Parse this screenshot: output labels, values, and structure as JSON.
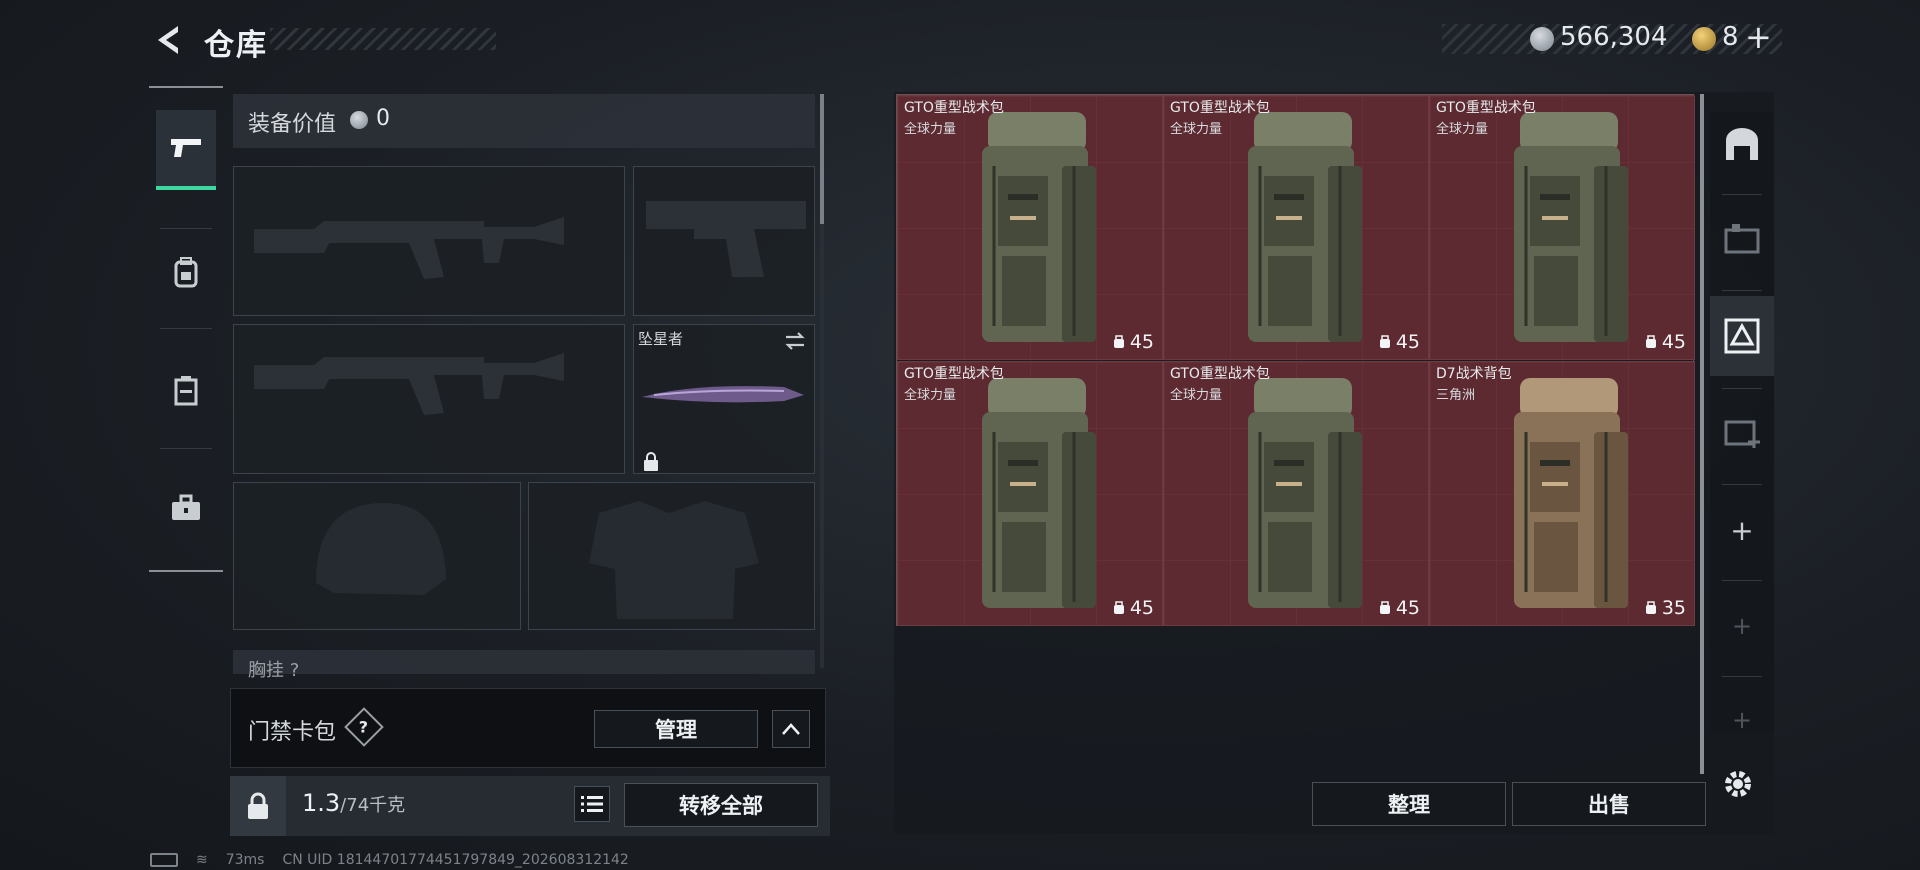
{
  "header": {
    "title": "仓库"
  },
  "currency": {
    "silver": "566,304",
    "gold": "8",
    "plus": "+"
  },
  "loadout": {
    "value_label": "装备价值",
    "value": "0",
    "melee_name": "坠星者",
    "chest_label": "胸挂",
    "chest_badge": "?"
  },
  "keycard": {
    "label": "门禁卡包",
    "help": "?",
    "manage": "管理"
  },
  "capacity": {
    "current": "1.3",
    "max": "/74千克",
    "transfer": "转移全部"
  },
  "inventory": {
    "items": [
      {
        "name": "GTO重型战术包",
        "brand": "全球力量",
        "capacity": "45",
        "tone": "green"
      },
      {
        "name": "GTO重型战术包",
        "brand": "全球力量",
        "capacity": "45",
        "tone": "green"
      },
      {
        "name": "GTO重型战术包",
        "brand": "全球力量",
        "capacity": "45",
        "tone": "green"
      },
      {
        "name": "GTO重型战术包",
        "brand": "全球力量",
        "capacity": "45",
        "tone": "green"
      },
      {
        "name": "GTO重型战术包",
        "brand": "全球力量",
        "capacity": "45",
        "tone": "green"
      },
      {
        "name": "D7战术背包",
        "brand": "三角洲",
        "capacity": "35",
        "tone": "tan"
      }
    ]
  },
  "actions": {
    "sort": "整理",
    "sell": "出售"
  },
  "status": {
    "ping": "73ms",
    "uid": "CN UID 1814470177445179784​9_202608312142"
  },
  "icons": [
    "back-icon",
    "pistol-icon",
    "backpack-nav-icon",
    "vest-nav-icon",
    "case-nav-icon",
    "silver-coin-icon",
    "gold-coin-icon",
    "lock-icon",
    "swap-icon",
    "list-icon",
    "chevron-up-icon",
    "settings-icon"
  ],
  "colors": {
    "accent": "#3fd7a0",
    "cell_bg": "#5c2a30",
    "text": "#d9dde2"
  }
}
